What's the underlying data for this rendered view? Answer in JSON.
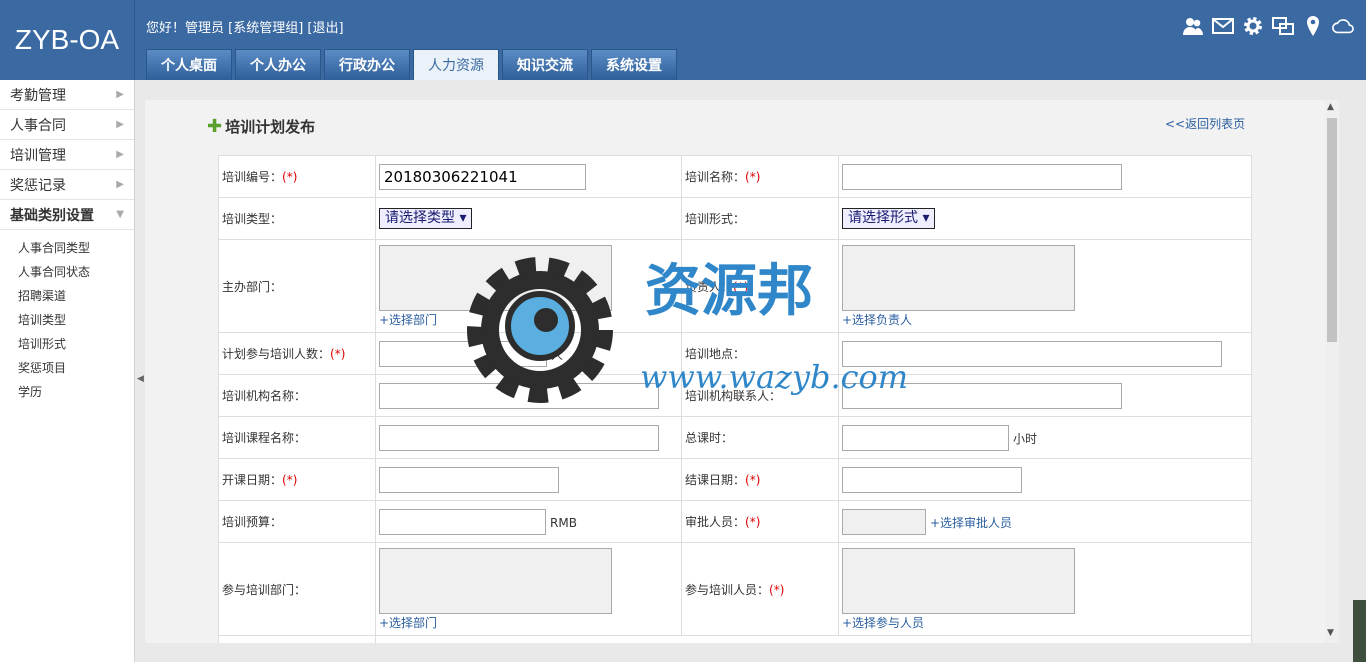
{
  "app": {
    "logo": "ZYB-OA"
  },
  "header": {
    "greeting": "您好！管理员 [系统管理组] [退出]",
    "tabs": [
      {
        "label": "个人桌面"
      },
      {
        "label": "个人办公"
      },
      {
        "label": "行政办公"
      },
      {
        "label": "人力资源"
      },
      {
        "label": "知识交流"
      },
      {
        "label": "系统设置"
      }
    ],
    "icons": [
      "users-icon",
      "mail-icon",
      "gear-icon",
      "screens-icon",
      "location-icon",
      "cloud-icon"
    ]
  },
  "sidebar": {
    "items": [
      {
        "label": "考勤管理"
      },
      {
        "label": "人事合同"
      },
      {
        "label": "培训管理"
      },
      {
        "label": "奖惩记录"
      },
      {
        "label": "基础类别设置"
      }
    ],
    "sub": [
      "人事合同类型",
      "人事合同状态",
      "招聘渠道",
      "培训类型",
      "培训形式",
      "奖惩项目",
      "学历"
    ]
  },
  "page": {
    "title": "培训计划发布",
    "back_link": "<<返回列表页"
  },
  "form": {
    "req": "(*)",
    "train_no_label": "培训编号：",
    "train_no_value": "20180306221041",
    "train_name_label": "培训名称：",
    "train_type_label": "培训类型：",
    "train_type_value": "请选择类型",
    "train_form_label": "培训形式：",
    "train_form_value": "请选择形式",
    "dept_label": "主办部门：",
    "select_dept": "+选择部门",
    "owner_label": "负责人：",
    "select_owner": "+选择负责人",
    "count_label": "计划参与培训人数：",
    "count_unit": "人",
    "place_label": "培训地点：",
    "org_label": "培训机构名称：",
    "org_contact_label": "培训机构联系人：",
    "course_label": "培训课程名称：",
    "hours_label": "总课时：",
    "hours_unit": "小时",
    "start_label": "开课日期：",
    "end_label": "结课日期：",
    "budget_label": "培训预算：",
    "budget_unit": "RMB",
    "approver_label": "审批人员：",
    "select_approver": "+选择审批人员",
    "part_dept_label": "参与培训部门：",
    "part_user_label": "参与培训人员：",
    "select_part_dept": "+选择部门",
    "select_part_user": "+选择参与人员"
  },
  "watermark": {
    "brand": "资源邦",
    "url": "www.wazyb.com"
  },
  "colors": {
    "header": "#3b6aa3",
    "link": "#2a5ea0",
    "required": "#dd0000"
  }
}
